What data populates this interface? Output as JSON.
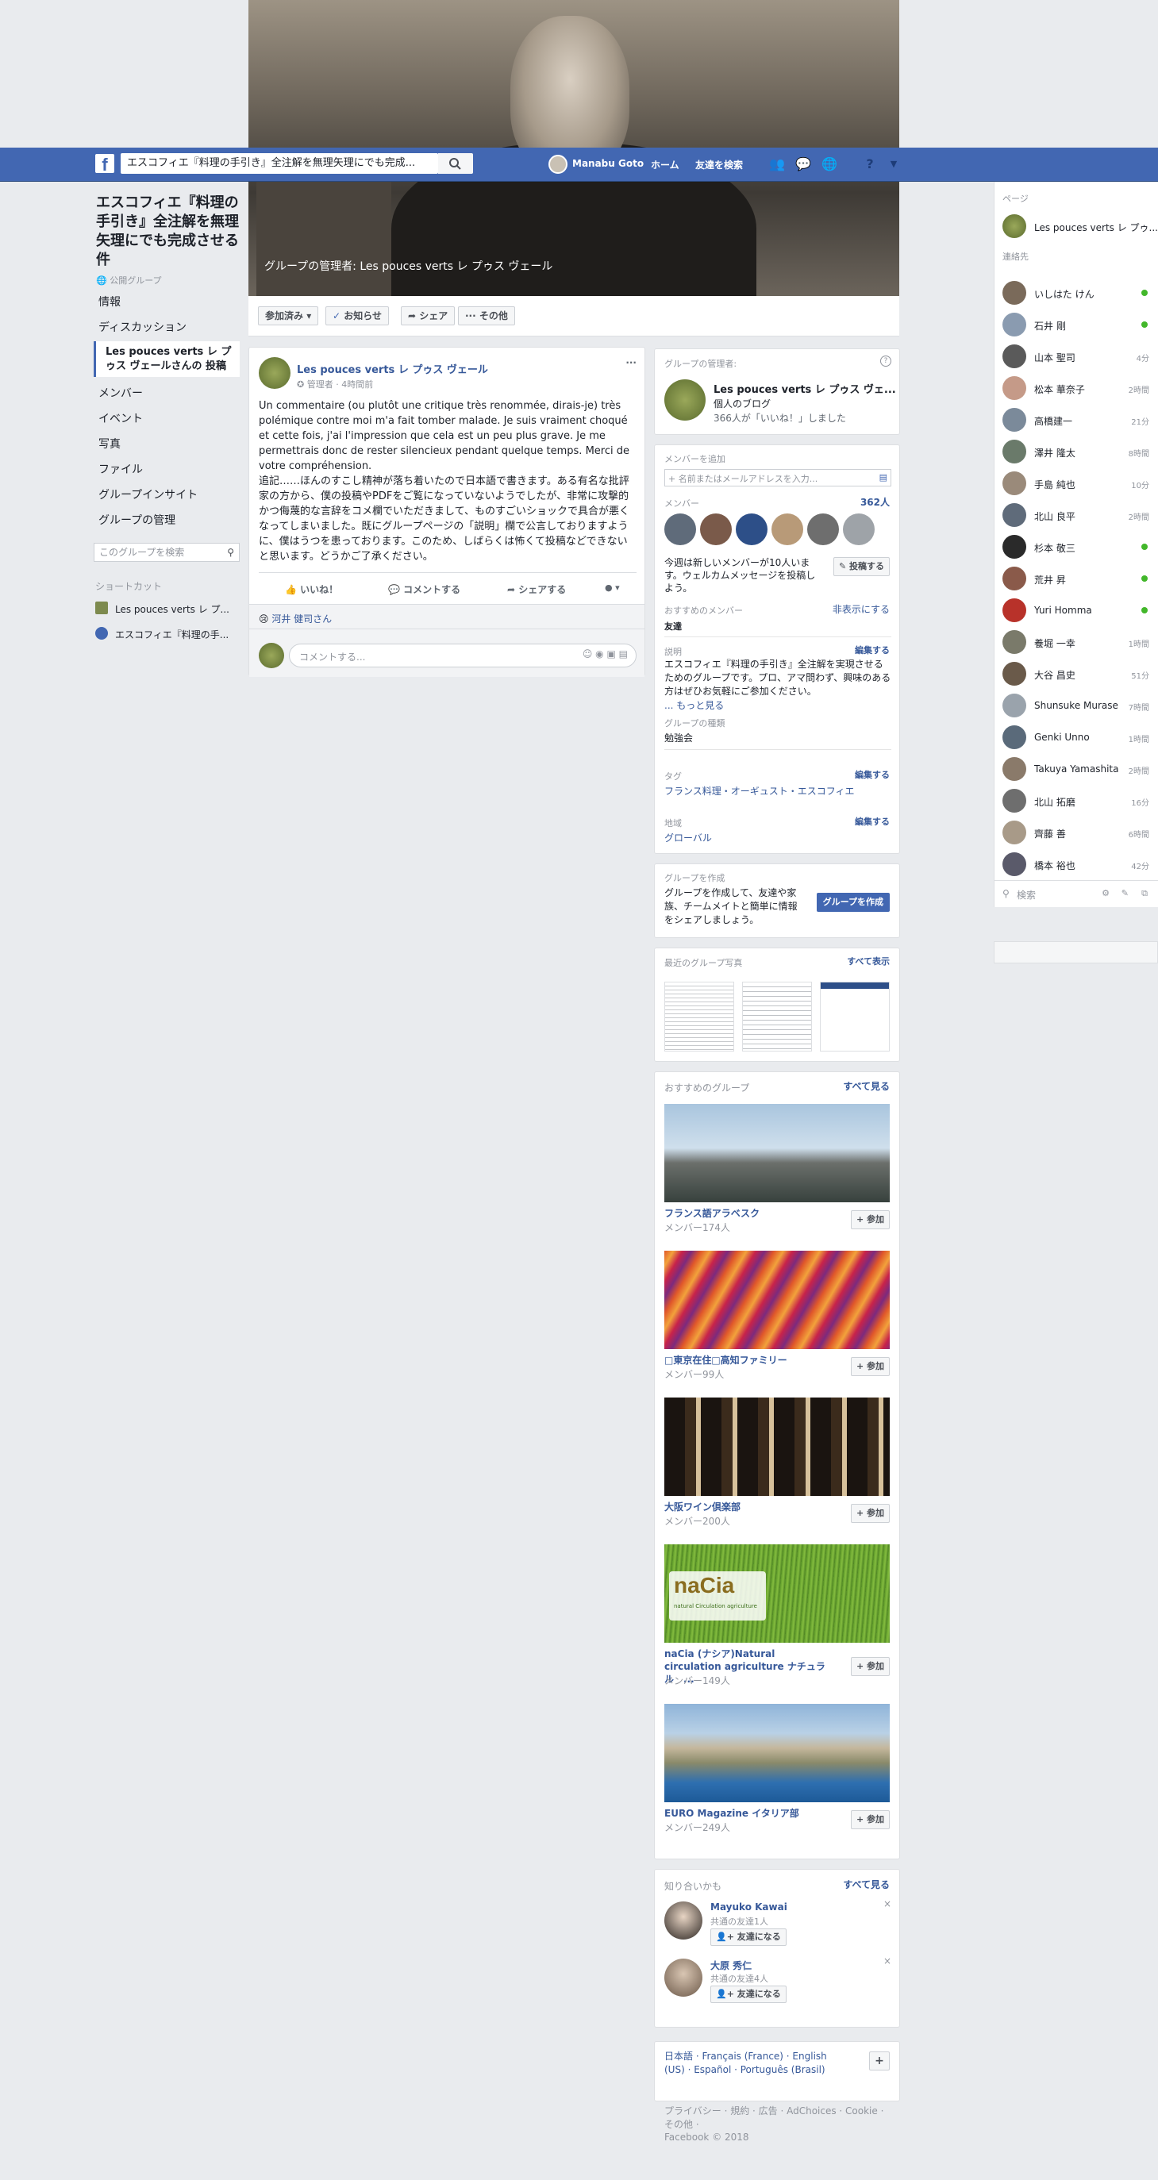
{
  "topbar": {
    "logo": "f",
    "search_value": "エスコフィエ『料理の手引き』全注解を無理矢理にでも完成...",
    "user_name": "Manabu Goto",
    "home": "ホーム",
    "find_friends": "友達を検索",
    "icons": [
      "friend-requests-icon",
      "messenger-icon",
      "globe-icon",
      "help-icon",
      "dropdown-icon"
    ]
  },
  "cover": {
    "caption": "グループの管理者: Les pouces verts レ プゥス ヴェール",
    "joined": "参加済み",
    "notifications": "お知らせ",
    "share": "シェア",
    "more": "その他"
  },
  "left": {
    "group_title": "エスコフィエ『料理の手引き』全注解を無理矢理にでも完成させる件",
    "privacy": "公開グループ",
    "nav": [
      "情報",
      "ディスカッション"
    ],
    "nav_active": "Les pouces verts レ プゥス ヴェールさんの 投稿",
    "nav2": [
      "メンバー",
      "イベント",
      "写真",
      "ファイル",
      "グループインサイト",
      "グループの管理"
    ],
    "search_placeholder": "このグループを検索",
    "shortcuts_header": "ショートカット",
    "shortcuts": [
      "Les pouces verts レ プ...",
      "エスコフィエ『料理の手..."
    ]
  },
  "post": {
    "author": "Les pouces verts レ プゥス ヴェール",
    "role": "管理者",
    "time": "4時間前",
    "body": "Un commentaire (ou plutôt une critique très renommée, dirais-je) très polémique contre moi m'a fait tomber malade. Je suis vraiment choqué et cette fois, j'ai l'impression que cela est un peu plus grave. Je me permettrais donc de rester silencieux pendant quelque temps. Merci de votre compréhension.\n追記……ほんのすこし精神が落ち着いたので日本語で書きます。ある有名な批評家の方から、僕の投稿やPDFをご覧になっていないようでしたが、非常に攻撃的かつ侮蔑的な言辞をコメ欄でいただきまして、ものすごいショックで具合が悪くなってしまいました。既にグループページの「説明」欄で公言しておりますように、僕はうつを患っております。このため、しばらくは怖くて投稿などできないと思います。どうかご了承ください。",
    "like": "いいね！",
    "comment": "コメントする",
    "share": "シェアする",
    "reactor": "河井 健司さん",
    "comment_placeholder": "コメントする..."
  },
  "admin_card": {
    "header": "グループの管理者:",
    "name": "Les pouces verts レ プゥス ヴェ...",
    "type": "個人のブログ",
    "likes": "366人が「いいね！」しました"
  },
  "members_card": {
    "add_header": "メンバーを追加",
    "add_placeholder": "+ 名前またはメールアドレスを入力...",
    "members_label": "メンバー",
    "members_count": "362人",
    "welcome": "今週は新しいメンバーが10人います。ウェルカムメッセージを投稿しよう。",
    "post_btn": "投稿する",
    "suggested_label": "おすすめのメンバー",
    "hide": "非表示にする",
    "friends": "友達",
    "desc_label": "説明",
    "edit": "編集する",
    "desc": "エスコフィエ『料理の手引き』全注解を実現させるためのグループです。プロ、アマ問わず、興味のある方はぜひお気軽にご参加ください。",
    "more": "... もっと見る",
    "type_label": "グループの種類",
    "type": "勉強会",
    "tags_label": "タグ",
    "tags": "フランス料理・オーギュスト・エスコフィエ",
    "region_label": "地域",
    "region": "グローバル"
  },
  "create_card": {
    "header": "グループを作成",
    "text": "グループを作成して、友達や家族、チームメイトと簡単に情報をシェアしましょう。",
    "button": "グループを作成"
  },
  "photos_card": {
    "header": "最近のグループ写真",
    "see_all": "すべて表示"
  },
  "recommended": {
    "header": "おすすめのグループ",
    "see_all": "すべて見る",
    "join": "+ 参加",
    "groups": [
      {
        "name": "フランス語アラベスク",
        "members": "メンバー174人"
      },
      {
        "name": "□東京在住□高知ファミリー",
        "members": "メンバー99人"
      },
      {
        "name": "大阪ワイン倶楽部",
        "members": "メンバー200人"
      },
      {
        "name": "naCia (ナシア)Natural circulation agriculture ナチュラル　...",
        "members": "メンバー149人",
        "logo": "naCia",
        "logo_sub": "natural Circulation agriculture"
      },
      {
        "name": "EURO Magazine イタリア部",
        "members": "メンバー249人"
      }
    ]
  },
  "pymk": {
    "header": "知り合いかも",
    "see_all": "すべて見る",
    "add": "友達になる",
    "people": [
      {
        "name": "Mayuko Kawai",
        "mutual": "共通の友達1人"
      },
      {
        "name": "大原 秀仁",
        "mutual": "共通の友達4人"
      }
    ]
  },
  "footer": {
    "languages": "日本語 · Français (France) · English (US) · Español · Português (Brasil)",
    "links": "プライバシー · 規約 · 広告 · AdChoices · Cookie · その他 ·",
    "copyright": "Facebook © 2018"
  },
  "chat": {
    "pages_header": "ページ",
    "page": "Les pouces verts レ プゥ...",
    "contacts_header": "連絡先",
    "contacts": [
      {
        "name": "いしはた けん",
        "status": "online"
      },
      {
        "name": "石井 剛",
        "status": "online"
      },
      {
        "name": "山本 聖司",
        "status": "4分"
      },
      {
        "name": "松本 華奈子",
        "status": "2時間"
      },
      {
        "name": "高橋建一",
        "status": "21分"
      },
      {
        "name": "澤井 隆太",
        "status": "8時間"
      },
      {
        "name": "手島 純也",
        "status": "10分"
      },
      {
        "name": "北山 良平",
        "status": "2時間"
      },
      {
        "name": "杉本 敬三",
        "status": "online"
      },
      {
        "name": "荒井 昇",
        "status": "online"
      },
      {
        "name": "Yuri Homma",
        "status": "online"
      },
      {
        "name": "養堀 一幸",
        "status": "1時間"
      },
      {
        "name": "大谷 昌史",
        "status": "51分"
      },
      {
        "name": "Shunsuke Murase",
        "status": "7時間"
      },
      {
        "name": "Genki Unno",
        "status": "1時間"
      },
      {
        "name": "Takuya Yamashita",
        "status": "2時間"
      },
      {
        "name": "北山 拓磨",
        "status": "16分"
      },
      {
        "name": "齊藤 善",
        "status": "6時間"
      },
      {
        "name": "橋本 裕也",
        "status": "42分"
      }
    ],
    "search_placeholder": "検索"
  },
  "colors": {
    "brand": "#4267b2",
    "link": "#365899",
    "online": "#42b72a",
    "background": "#e9ebee"
  }
}
